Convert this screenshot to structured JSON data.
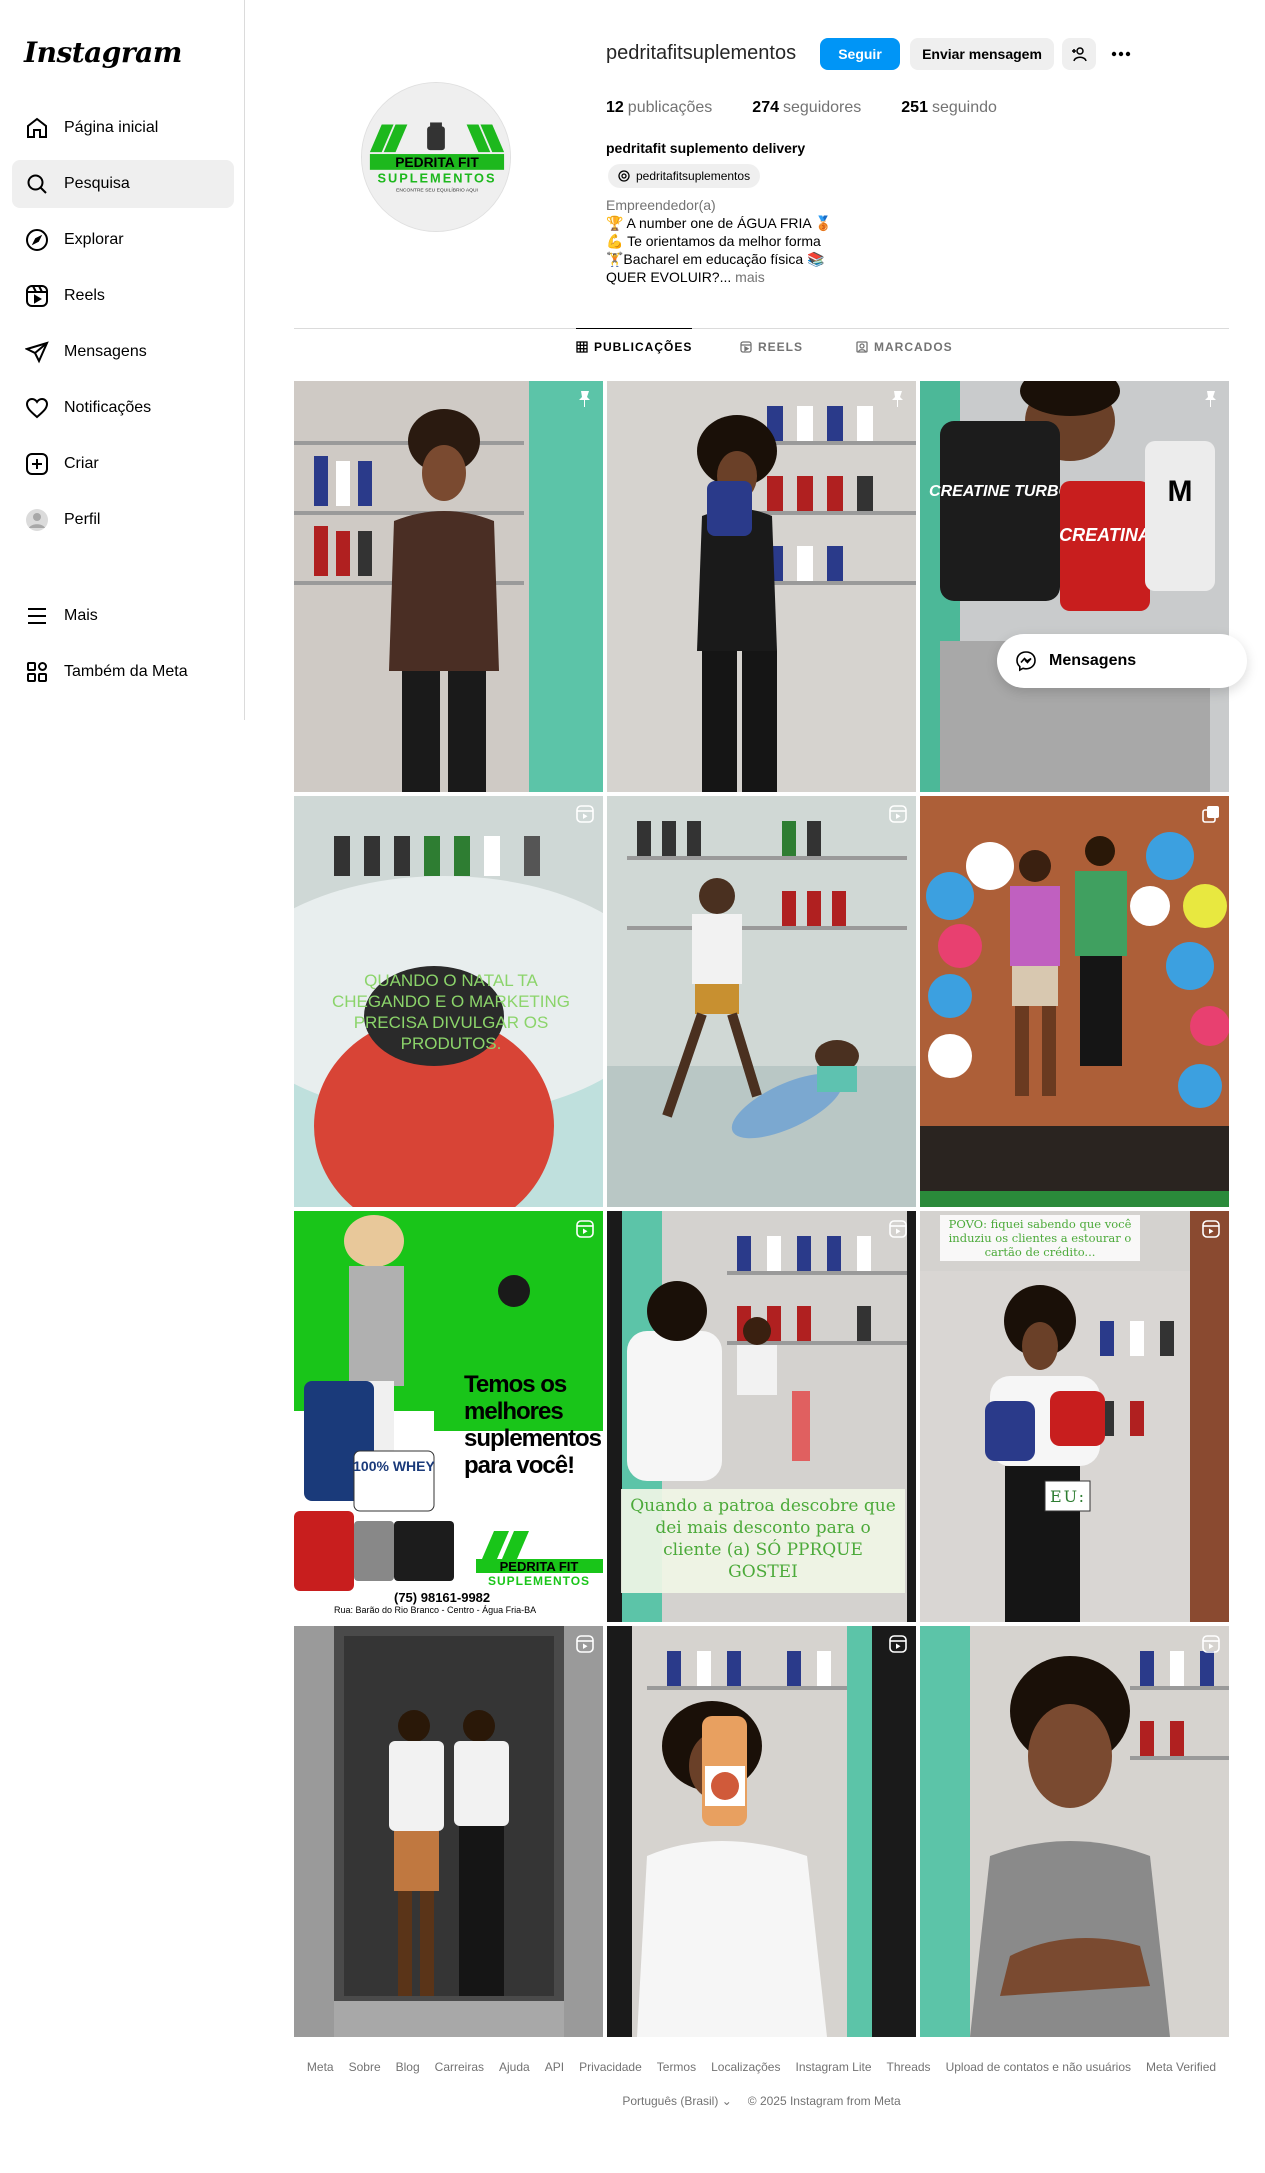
{
  "app": {
    "logo": "Instagram"
  },
  "sidebar": {
    "items": [
      {
        "label": "Página inicial",
        "icon": "home-icon"
      },
      {
        "label": "Pesquisa",
        "icon": "search-icon"
      },
      {
        "label": "Explorar",
        "icon": "compass-icon"
      },
      {
        "label": "Reels",
        "icon": "reels-icon"
      },
      {
        "label": "Mensagens",
        "icon": "messenger-icon"
      },
      {
        "label": "Notificações",
        "icon": "heart-icon"
      },
      {
        "label": "Criar",
        "icon": "plus-icon"
      },
      {
        "label": "Perfil",
        "icon": "avatar-icon"
      }
    ],
    "more": "Mais",
    "meta": "Também da Meta"
  },
  "profile": {
    "username": "pedritafitsuplementos",
    "follow": "Seguir",
    "message": "Enviar mensagem",
    "posts_count": "12",
    "posts_label": "publicações",
    "followers_count": "274",
    "followers_label": "seguidores",
    "following_count": "251",
    "following_label": "seguindo",
    "full_name": "pedritafit suplemento delivery",
    "threads": "pedritafitsuplementos",
    "category": "Empreendedor(a)",
    "bio": [
      "🏆 A number one de ÁGUA FRIA 🥉",
      "💪 Te orientamos da melhor forma",
      "🏋️Bacharel em educação física 📚",
      "QUER EVOLUIR?..."
    ],
    "bio_more": "mais",
    "logo_line1": "PEDRITA FIT",
    "logo_line2": "SUPLEMENTOS",
    "logo_line3": "ENCONTRE SEU EQUILÍBRIO AQUI"
  },
  "tabs": [
    {
      "label": "PUBLICAÇÕES"
    },
    {
      "label": "REELS"
    },
    {
      "label": "MARCADOS"
    }
  ],
  "posts": {
    "p4_caption": "QUANDO O NATAL TA CHEGANDO E O MARKETING PRECISA DIVULGAR OS PRODUTOS.",
    "p7_title": "Temos os melhores suplementos para você!",
    "p7_phone": "(75) 98161-9982",
    "p7_address": "Rua: Barão do Rio Branco - Centro - Água Fria-BA",
    "p7_whey": "100% WHEY",
    "p8_caption": "Quando a patroa descobre que dei mais desconto para o cliente (a) SÓ PPRQUE GOSTEI",
    "p9_caption": "POVO: fiquei sabendo que você induziu os clientes a estourar o cartão de crédito...",
    "p9_label": "EU:",
    "p3_label1": "CREATINE TURBO",
    "p3_label2": "CREATINA"
  },
  "floating": {
    "label": "Mensagens"
  },
  "footer": {
    "links": [
      "Meta",
      "Sobre",
      "Blog",
      "Carreiras",
      "Ajuda",
      "API",
      "Privacidade",
      "Termos",
      "Localizações",
      "Instagram Lite",
      "Threads",
      "Upload de contatos e não usuários",
      "Meta Verified"
    ],
    "language": "Português (Brasil)",
    "copyright": "© 2025 Instagram from Meta"
  }
}
